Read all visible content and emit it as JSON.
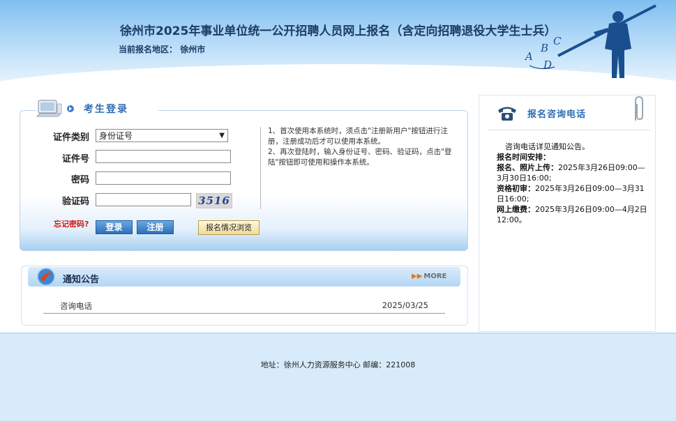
{
  "header": {
    "title": "徐州市2025年事业单位统一公开招聘人员网上报名（含定向招聘退役大学生士兵）",
    "region_label": "当前报名地区：",
    "region_value": "徐州市",
    "deco_letters": [
      "A",
      "B",
      "C",
      "D"
    ]
  },
  "login": {
    "heading": "考生登录",
    "fields": {
      "id_type_label": "证件类别",
      "id_type_value": "身份证号",
      "id_number_label": "证件号",
      "password_label": "密码",
      "captcha_label": "验证码"
    },
    "captcha_text": "3516",
    "forgot_password": "忘记密码?",
    "login_button": "登录",
    "register_button": "注册",
    "browse_button": "报名情况浏览",
    "notes": [
      "1、首次使用本系统时，须点击\"注册新用户\"按钮进行注册，注册成功后才可以使用本系统。",
      "2、再次登陆时，输入身份证号、密码、验证码，点击\"登陆\"按钮即可使用和操作本系统。"
    ]
  },
  "notice": {
    "title": "通知公告",
    "more": "MORE",
    "items": [
      {
        "title": "咨询电话",
        "date": "2025/03/25"
      }
    ]
  },
  "contact": {
    "title": "报名咨询电话",
    "intro": "咨询电话详见通知公告。",
    "schedule_heading": "报名时间安排：",
    "schedule": [
      {
        "label": "报名、照片上传：",
        "value": "2025年3月26日09:00—3月30日16:00;"
      },
      {
        "label": "资格初审：",
        "value": "2025年3月26日09:00—3月31日16:00;"
      },
      {
        "label": "网上缴费：",
        "value": "2025年3月26日09:00—4月2日12:00。"
      }
    ]
  },
  "footer": {
    "address": "地址：徐州人力资源服务中心  邮编：221008"
  },
  "colors": {
    "accent_blue": "#2d6db5",
    "title_navy": "#1e3c68",
    "forgot_red": "#d01818"
  }
}
